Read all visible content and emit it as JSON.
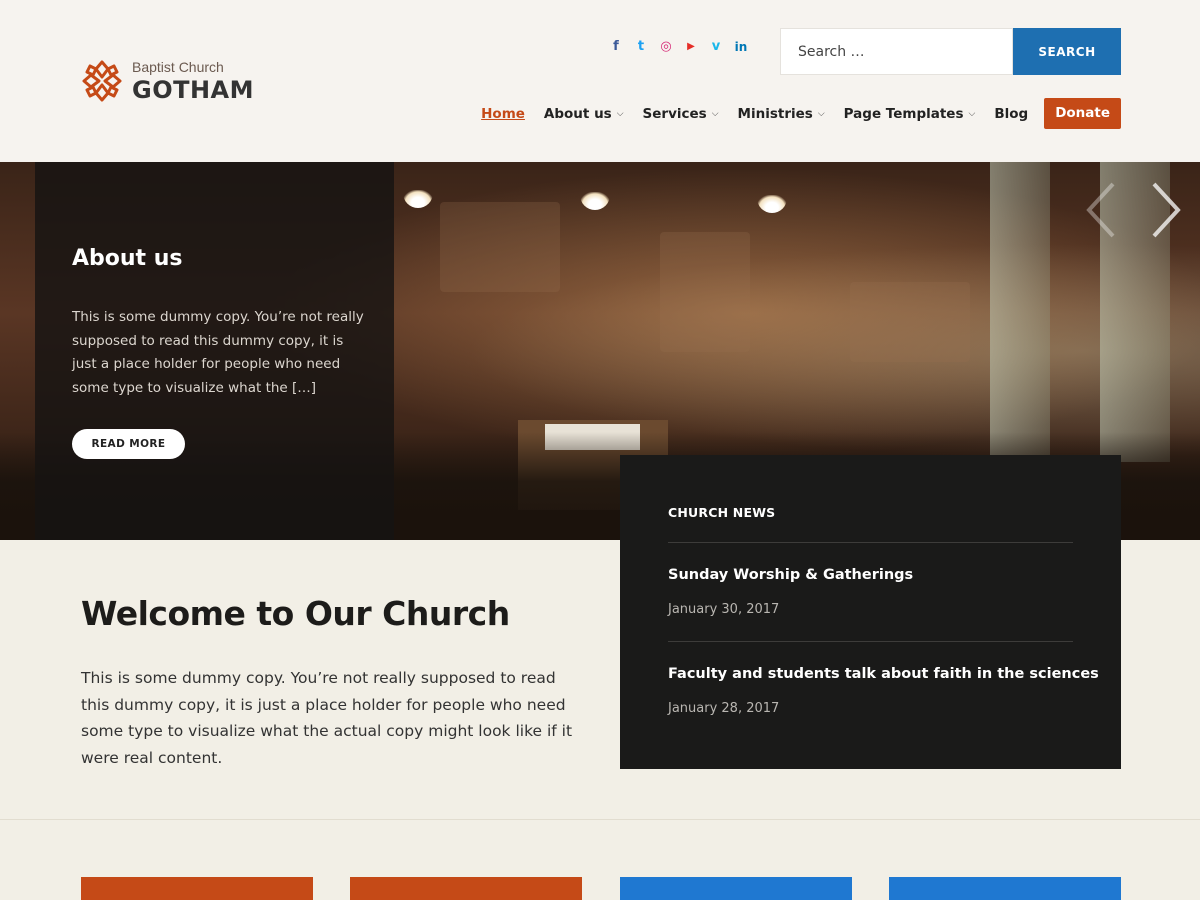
{
  "brand": {
    "subtitle": "Baptist Church",
    "name": "GOTHAM",
    "logo_color": "#c54a17"
  },
  "social": [
    {
      "icon": "facebook-icon",
      "glyph": "f",
      "color": "#3b5998"
    },
    {
      "icon": "twitter-icon",
      "glyph": "t",
      "color": "#1da1f2"
    },
    {
      "icon": "instagram-icon",
      "glyph": "◎",
      "color": "#d62976"
    },
    {
      "icon": "youtube-icon",
      "glyph": "▶",
      "color": "#e52d27"
    },
    {
      "icon": "vimeo-icon",
      "glyph": "v",
      "color": "#1ab7ea"
    },
    {
      "icon": "linkedin-icon",
      "glyph": "in",
      "color": "#0077b5"
    }
  ],
  "search": {
    "placeholder": "Search …",
    "button_label": "SEARCH"
  },
  "nav": {
    "items": [
      {
        "label": "Home",
        "active": true,
        "dropdown": false
      },
      {
        "label": "About us",
        "active": false,
        "dropdown": true
      },
      {
        "label": "Services",
        "active": false,
        "dropdown": true
      },
      {
        "label": "Ministries",
        "active": false,
        "dropdown": true
      },
      {
        "label": "Page Templates",
        "active": false,
        "dropdown": true
      },
      {
        "label": "Blog",
        "active": false,
        "dropdown": false
      }
    ],
    "donate_label": "Donate"
  },
  "hero": {
    "title": "About us",
    "text": "This is some dummy copy. You’re not really supposed to read this dummy copy, it is just a place holder for people who need some type to visualize what the […]",
    "button_label": "READ MORE"
  },
  "news": {
    "heading": "CHURCH NEWS",
    "items": [
      {
        "title": "Sunday Worship & Gatherings",
        "date": "January 30, 2017"
      },
      {
        "title": "Faculty and students talk about faith in the sciences",
        "date": "January 28, 2017"
      }
    ]
  },
  "welcome": {
    "title": "Welcome to Our Church",
    "text": "This is some dummy copy. You’re not really supposed to read this dummy copy, it is just a place holder for people who need some type to visualize what the actual copy might look like if it were real content."
  },
  "colors": {
    "accent": "#c54a17",
    "blue": "#1e6fb1",
    "card_blue": "#1f78d1",
    "dark": "#1a1a19"
  }
}
